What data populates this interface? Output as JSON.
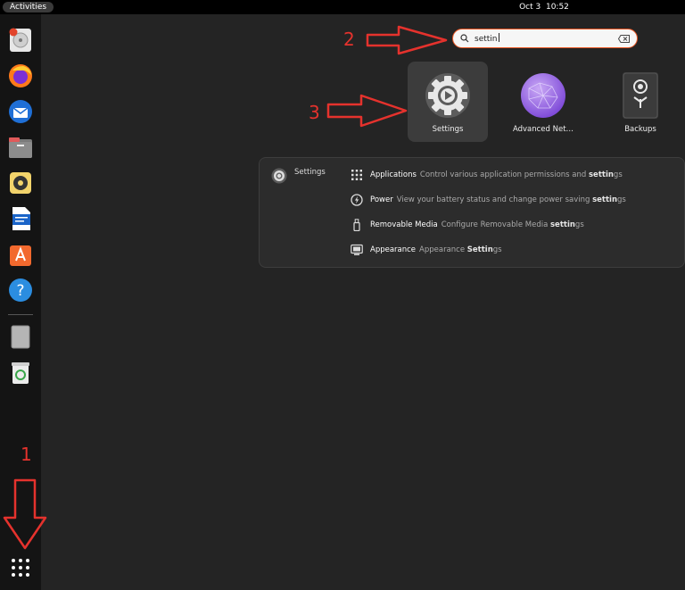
{
  "topbar": {
    "activities": "Activities",
    "date": "Oct 3",
    "time": "10:52"
  },
  "search": {
    "value": "settin"
  },
  "apps": [
    {
      "label": "Settings",
      "icon": "settings-gear-icon"
    },
    {
      "label": "Advanced Net…",
      "icon": "advanced-network-icon"
    },
    {
      "label": "Backups",
      "icon": "backups-icon"
    }
  ],
  "provider": {
    "name": "Settings",
    "results": [
      {
        "title": "Applications",
        "desc_pre": "Control various application permissions and ",
        "desc_bold": "settin",
        "desc_post": "gs",
        "icon": "applications-grid-icon"
      },
      {
        "title": "Power",
        "desc_pre": "View your battery status and change power saving ",
        "desc_bold": "settin",
        "desc_post": "gs",
        "icon": "power-icon"
      },
      {
        "title": "Removable Media",
        "desc_pre": "Configure Removable Media ",
        "desc_bold": "settin",
        "desc_post": "gs",
        "icon": "usb-stick-icon"
      },
      {
        "title": "Appearance",
        "desc_pre": "Appearance ",
        "desc_bold": "Settin",
        "desc_post": "gs",
        "icon": "appearance-icon"
      }
    ]
  },
  "annotations": {
    "one": "1",
    "two": "2",
    "three": "3"
  },
  "colors": {
    "accent": "#e95420",
    "annotation": "#e5322d"
  }
}
